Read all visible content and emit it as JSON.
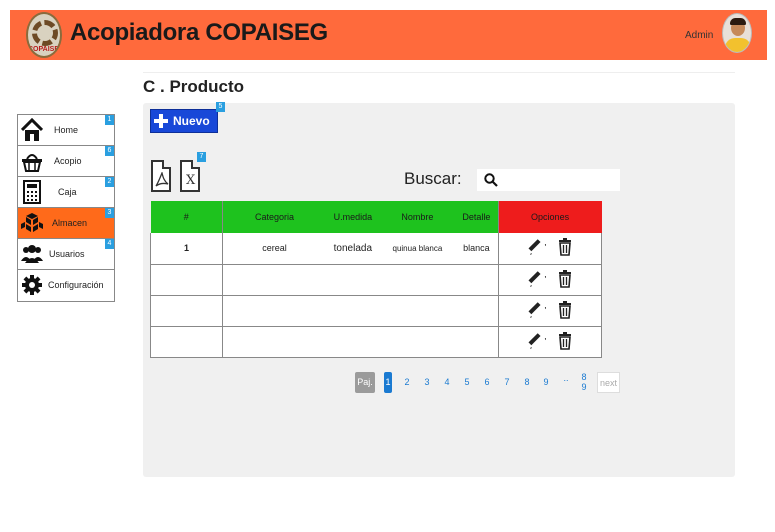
{
  "header": {
    "logo_text": "COPAISEG",
    "title": "Acopiadora COPAISEG",
    "user": "Admin"
  },
  "page": {
    "title": "C . Producto"
  },
  "toolbar": {
    "new_label": "Nuevo",
    "new_badge": "5",
    "export_badge": "7",
    "xls_glyph": "X",
    "search_label": "Buscar:",
    "search_placeholder": "",
    "search_value": ""
  },
  "table": {
    "headers": [
      "#",
      "Categoria",
      "U.medida",
      "Nombre",
      "Detalle",
      "Opciones"
    ],
    "rows": [
      {
        "num": "1",
        "category": "cereal",
        "unit": "tonelada",
        "name": "quinua blanca",
        "detail": "blanca"
      },
      {
        "num": "",
        "category": "",
        "unit": "",
        "name": "",
        "detail": ""
      },
      {
        "num": "",
        "category": "",
        "unit": "",
        "name": "",
        "detail": ""
      },
      {
        "num": "",
        "category": "",
        "unit": "",
        "name": "",
        "detail": ""
      }
    ]
  },
  "pagination": {
    "label": "Paj.",
    "pages": [
      "1",
      "2",
      "3",
      "4",
      "5",
      "6",
      "7",
      "8",
      "9",
      "..",
      "9"
    ],
    "last_top": "8",
    "active": "1",
    "next": "next"
  },
  "sidebar": {
    "items": [
      {
        "label": "Home",
        "badge": "1",
        "icon": "home-icon"
      },
      {
        "label": "Acopio",
        "badge": "6",
        "icon": "basket-icon"
      },
      {
        "label": "Caja",
        "badge": "2",
        "icon": "calculator-icon"
      },
      {
        "label": "Almacen",
        "badge": "3",
        "icon": "boxes-icon"
      },
      {
        "label": "Usuarios",
        "badge": "4",
        "icon": "users-icon"
      },
      {
        "label": "Configuración",
        "badge": "",
        "icon": "gear-icon"
      }
    ]
  },
  "colors": {
    "header_bg": "#ff6a3c",
    "accent_blue": "#1848d8",
    "table_header_green": "#1ec21e",
    "table_header_red": "#ee1c1c",
    "sidebar_active": "#ff6a1a",
    "badge": "#2a9fe0"
  }
}
